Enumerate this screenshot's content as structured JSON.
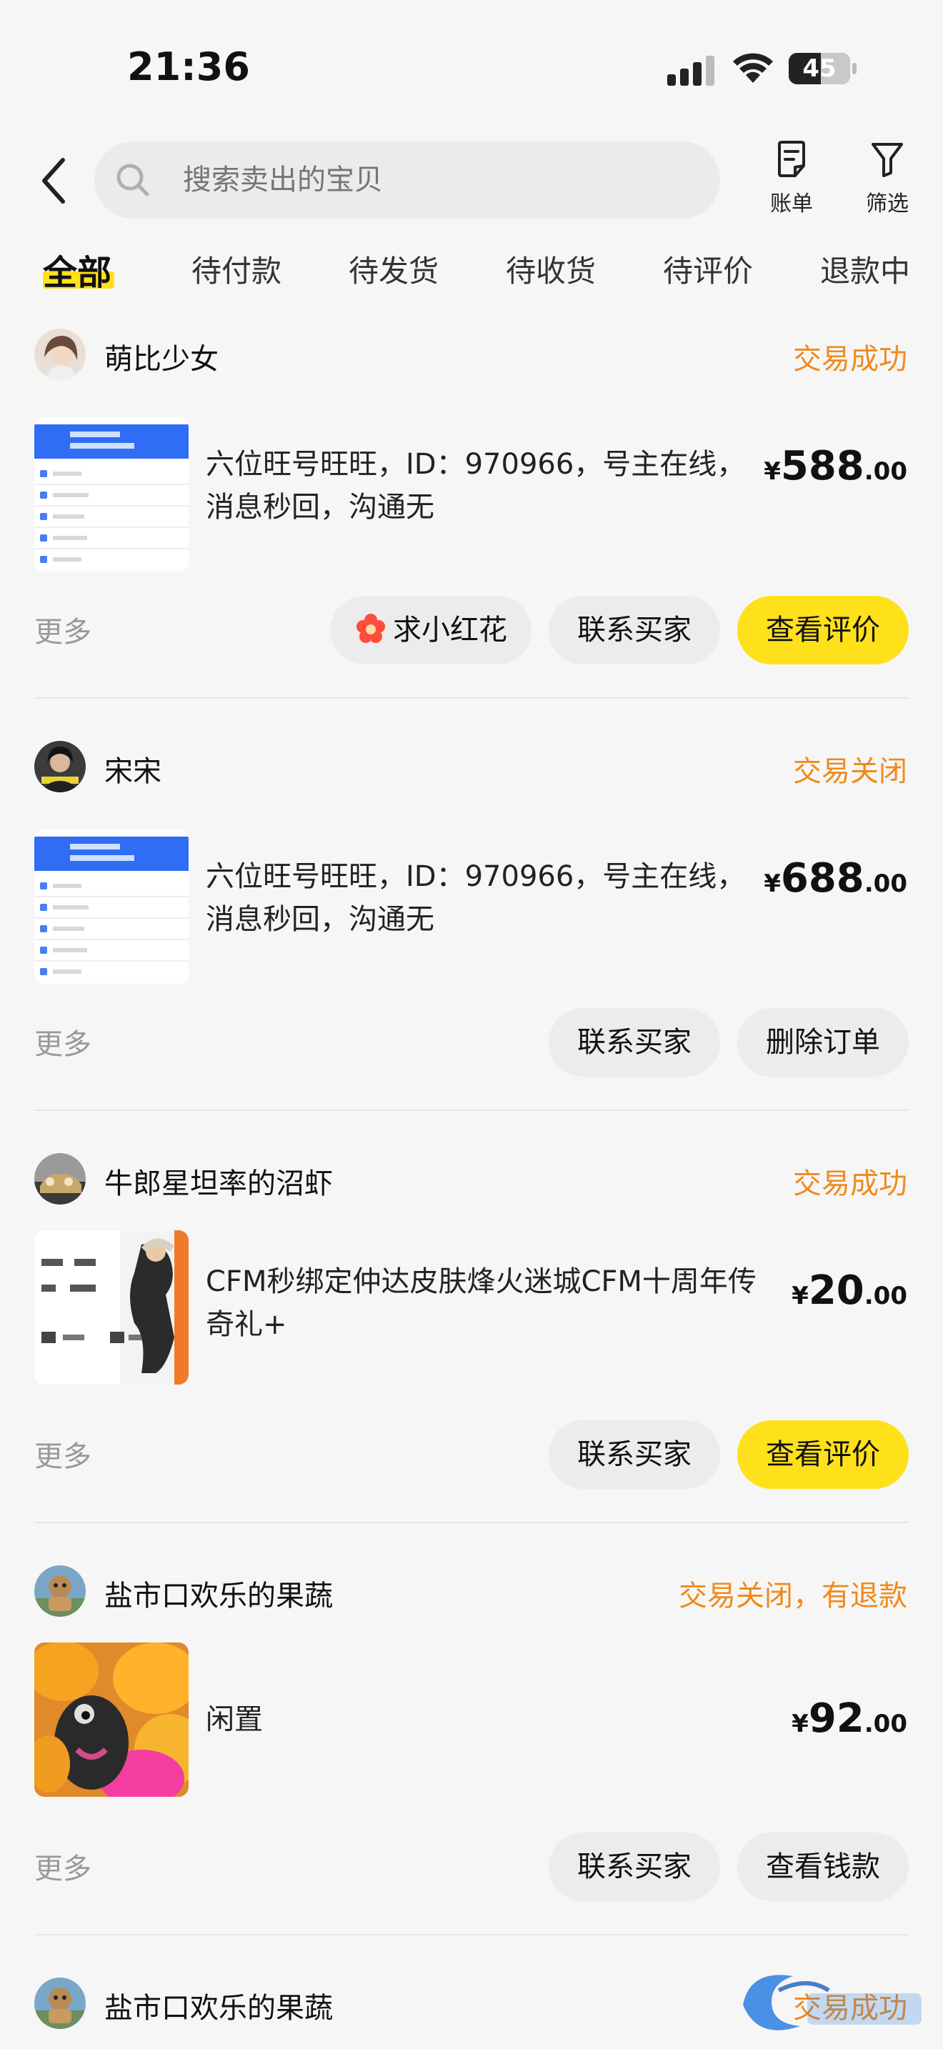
{
  "status_bar": {
    "time": "21:36",
    "battery": "45"
  },
  "search": {
    "placeholder": "搜索卖出的宝贝"
  },
  "header_actions": {
    "bill": "账单",
    "filter": "筛选"
  },
  "tabs": [
    "全部",
    "待付款",
    "待发货",
    "待收货",
    "待评价",
    "退款中"
  ],
  "orders": [
    {
      "buyer": "萌比少女",
      "status": "交易成功",
      "title": "六位旺号旺旺，ID：970966，号主在线，消息秒回，沟通无",
      "price": {
        "yen": "¥",
        "int": "588",
        "dec": ".00"
      },
      "more": "更多",
      "buttons": [
        "求小红花",
        "联系买家",
        "查看评价"
      ]
    },
    {
      "buyer": "宋宋",
      "status": "交易关闭",
      "title": "六位旺号旺旺，ID：970966，号主在线，消息秒回，沟通无",
      "price": {
        "yen": "¥",
        "int": "688",
        "dec": ".00"
      },
      "more": "更多",
      "buttons": [
        "联系买家",
        "删除订单"
      ]
    },
    {
      "buyer": "牛郎星坦率的沼虾",
      "status": "交易成功",
      "title": "CFM秒绑定仲达皮肤烽火迷城CFM十周年传奇礼+",
      "price": {
        "yen": "¥",
        "int": "20",
        "dec": ".00"
      },
      "more": "更多",
      "buttons": [
        "联系买家",
        "查看评价"
      ]
    },
    {
      "buyer": "盐市口欢乐的果蔬",
      "status": "交易关闭，有退款",
      "title": "闲置",
      "price": {
        "yen": "¥",
        "int": "92",
        "dec": ".00"
      },
      "more": "更多",
      "buttons": [
        "联系买家",
        "查看钱款"
      ]
    },
    {
      "buyer": "盐市口欢乐的果蔬",
      "status": "交易成功"
    }
  ],
  "colors": {
    "accent_yellow": "#ffe11b",
    "status_orange": "#f08a1c",
    "background": "#f6f6f6"
  }
}
